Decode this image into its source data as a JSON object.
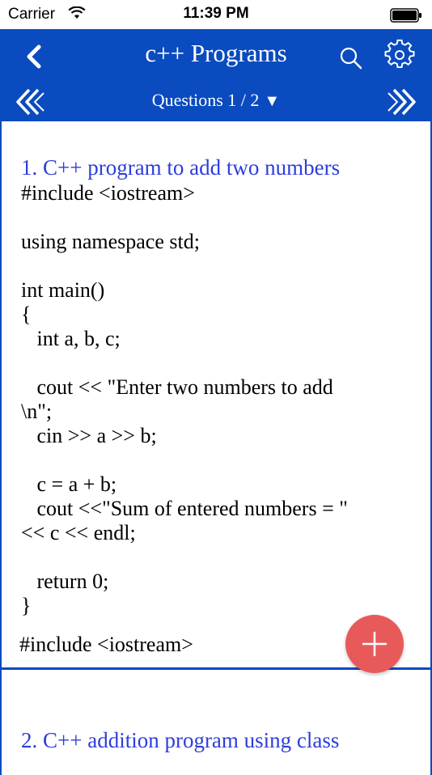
{
  "status_bar": {
    "carrier": "Carrier",
    "time": "11:39 PM"
  },
  "nav": {
    "title": "c++ Programs",
    "questions_label": "Questions 1 / 2",
    "dropdown_glyph": "▼"
  },
  "questions": [
    {
      "title": "1. C++ program to add two numbers",
      "code": "#include <iostream>\n\nusing namespace std;\n\nint main()\n{\n   int a, b, c;\n\n   cout << \"Enter two numbers to add\n\\n\";\n   cin >> a >> b;\n\n   c = a + b;\n   cout <<\"Sum of entered numbers = \"\n<< c << endl;\n\n   return 0;\n}"
    },
    {
      "title": "2. C++ addition program using class",
      "code": "#include <iostream>"
    }
  ],
  "colors": {
    "nav_bg": "#0a4bbf",
    "title_blue": "#2d3ddb",
    "fab": "#e85a5a"
  },
  "icons": [
    "back-icon",
    "search-icon",
    "gear-icon",
    "double-chevron-left-icon",
    "double-chevron-right-icon",
    "plus-icon"
  ]
}
